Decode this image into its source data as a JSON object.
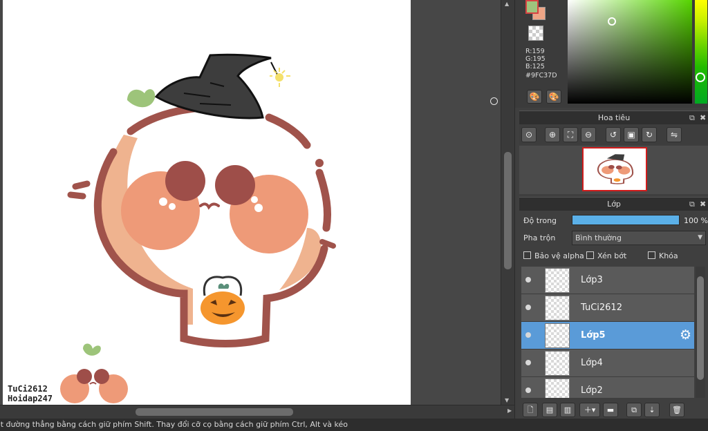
{
  "status_bar": {
    "text": "ột đường thẳng bằng cách giữ phím Shift. Thay đổi cỡ cọ bằng cách giữ phím Ctrl, Alt và kéo"
  },
  "canvas": {
    "watermark_line1": "TuCi2612",
    "watermark_line2": "Hoidap247"
  },
  "color_panel": {
    "foreground_color": "#9FC37D",
    "background_color": "#EEA586",
    "r": "R:159",
    "g": "G:195",
    "b": "B:125",
    "hex": "#9FC37D"
  },
  "navigator": {
    "title": "Hoa tiêu"
  },
  "layers": {
    "title": "Lớp",
    "opacity_label": "Độ trong",
    "opacity_value": "100 %",
    "opacity_fraction": 1.0,
    "blend_label": "Pha trộn",
    "blend_value": "Bình thường",
    "protect_alpha": "Bảo vệ alpha",
    "clipping": "Xén bớt",
    "lock": "Khóa",
    "items": [
      {
        "name": "Lớp3",
        "selected": false
      },
      {
        "name": "TuCi2612",
        "selected": false
      },
      {
        "name": "Lớp5",
        "selected": true
      },
      {
        "name": "Lớp4",
        "selected": false
      },
      {
        "name": "Lớp2",
        "selected": false
      }
    ]
  },
  "colors": {
    "accent_selection": "#5A9BD8",
    "nav_frame": "#D11C1C",
    "opacity_bar": "#5BB0E8"
  }
}
